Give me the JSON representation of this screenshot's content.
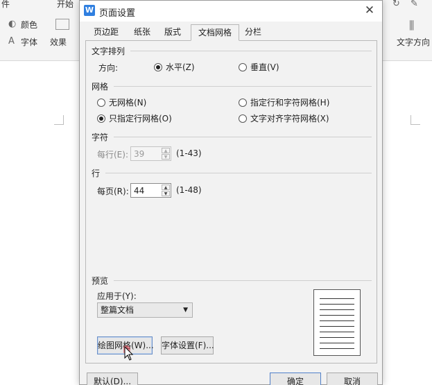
{
  "background": {
    "ribbon_items": [
      "件",
      "开始",
      "颜色",
      "字体",
      "效果",
      "文字方向"
    ]
  },
  "dialog": {
    "title": "页面设置",
    "close_glyph": "✕",
    "tabs": [
      "页边距",
      "纸张",
      "版式",
      "文档网格",
      "分栏"
    ],
    "active_tab": "文档网格",
    "text_direction": {
      "group_label": "文字排列",
      "direction_label": "方向:",
      "options": [
        {
          "label": "水平(Z)",
          "selected": true
        },
        {
          "label": "垂直(V)",
          "selected": false
        }
      ]
    },
    "grid": {
      "group_label": "网格",
      "options": [
        {
          "label": "无网格(N)",
          "selected": false
        },
        {
          "label": "指定行和字符网格(H)",
          "selected": false
        },
        {
          "label": "只指定行网格(O)",
          "selected": true
        },
        {
          "label": "文字对齐字符网格(X)",
          "selected": false
        }
      ]
    },
    "characters": {
      "group_label": "字符",
      "per_line_label": "每行(E):",
      "per_line_value": "39",
      "per_line_range": "(1-43)"
    },
    "lines": {
      "group_label": "行",
      "per_page_label": "每页(R):",
      "per_page_value": "44",
      "per_page_range": "(1-48)"
    },
    "preview": {
      "group_label": "预览",
      "apply_to_label": "应用于(Y):",
      "apply_to_value": "整篇文档"
    },
    "buttons": {
      "draw_grid": "绘图网格(W)...",
      "font_settings": "字体设置(F)...",
      "default": "默认(D)...",
      "ok": "确定",
      "cancel": "取消"
    }
  }
}
